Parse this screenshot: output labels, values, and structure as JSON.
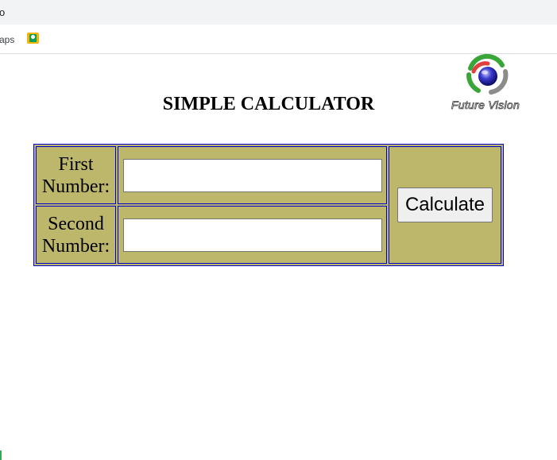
{
  "browser": {
    "address_fragment": "o",
    "bookmark_apps_label": "aps",
    "bookmark_icon": "user-bookmark-icon"
  },
  "page": {
    "title": "SIMPLE CALCULATOR",
    "logo_text": "Future Vision"
  },
  "calculator": {
    "first_label_line1": "First",
    "first_label_line2": "Number:",
    "second_label_line1": "Second",
    "second_label_line2": "Number:",
    "first_value": "",
    "second_value": "",
    "button_label": "Calculate"
  },
  "colors": {
    "table_background": "#bdb76b",
    "table_border": "#0000cc"
  }
}
